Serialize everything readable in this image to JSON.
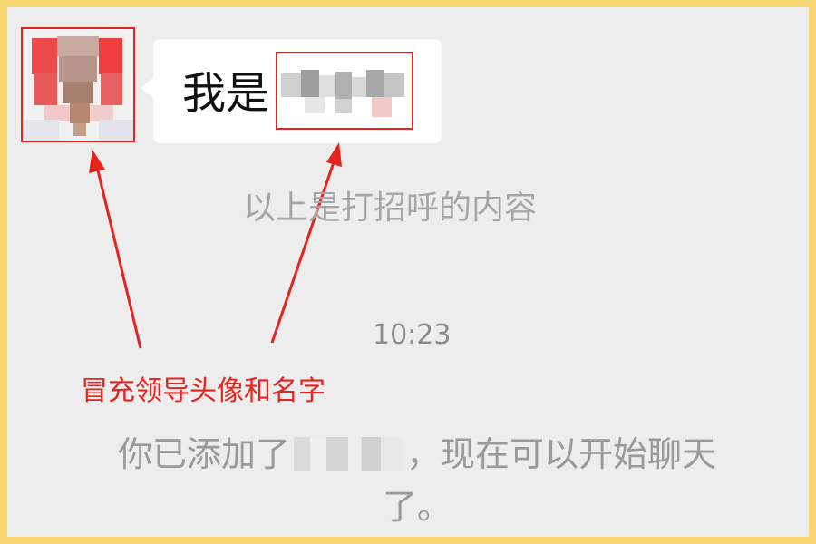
{
  "chat": {
    "bubble_text": "我是",
    "greeting_note": "以上是打招呼的内容",
    "timestamp": "10:23",
    "system_message_prefix": "你已添加了",
    "system_message_suffix": "，现在可以开始聊天",
    "system_message_end": "了。"
  },
  "annotation": {
    "text": "冒充领导头像和名字",
    "color": "#e5231f"
  },
  "colors": {
    "frame": "#f9d773",
    "background": "#ededed",
    "bubble": "#ffffff",
    "highlight": "#e5231f"
  }
}
